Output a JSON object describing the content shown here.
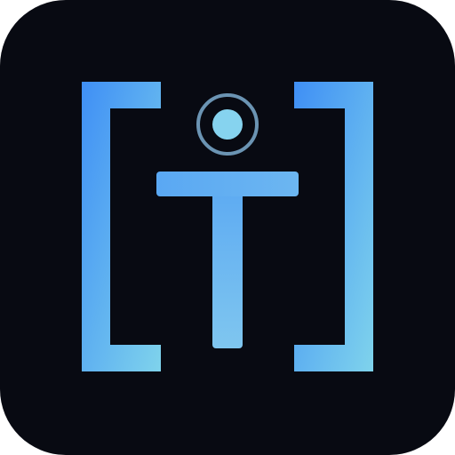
{
  "icon": {
    "name": "bracketed-info-person-app-icon",
    "colors": {
      "background": "#080a12",
      "gradient_start": "#3f8ff5",
      "gradient_end": "#7fd3ec",
      "ring": "#6b94b3",
      "dot": "#86d3ef"
    }
  }
}
